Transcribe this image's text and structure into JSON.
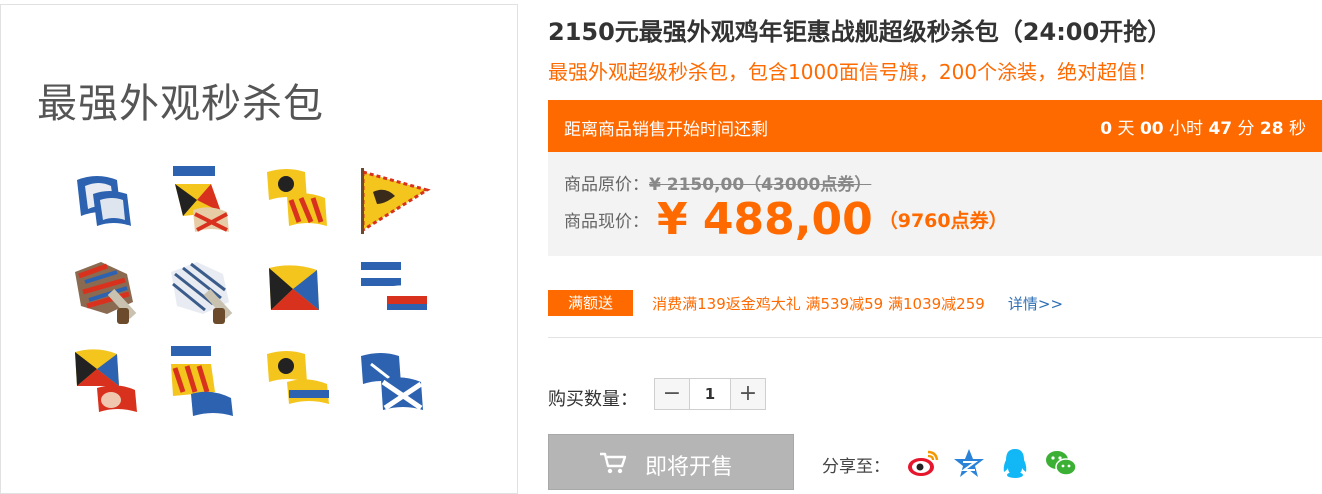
{
  "image_panel": {
    "title": "最强外观秒杀包"
  },
  "product": {
    "title": "2150元最强外观鸡年钜惠战舰超级秒杀包（24:00开抢）",
    "subtitle": "最强外观超级秒杀包，包含1000面信号旗，200个涂装，绝对超值！"
  },
  "countdown": {
    "label": "距离商品销售开始时间还剩",
    "days": "0",
    "days_unit": "天",
    "hours": "00",
    "hours_unit": "小时",
    "minutes": "47",
    "minutes_unit": "分",
    "seconds": "28",
    "seconds_unit": "秒"
  },
  "price": {
    "original_label": "商品原价：",
    "original_value": "¥ 2150,00（43000点券）",
    "current_label": "商品现价：",
    "current_value": "¥ 488,00",
    "current_points": "（9760点券）"
  },
  "promo": {
    "badge": "满额送",
    "text": "消费满139返金鸡大礼 满539减59 满1039减259",
    "detail_link": "详情>>"
  },
  "quantity": {
    "label": "购买数量：",
    "minus": "−",
    "plus": "+",
    "value": "1"
  },
  "buy_button": {
    "label": "即将开售",
    "icon": "cart-icon"
  },
  "share": {
    "label": "分享至：",
    "icons": [
      "weibo-icon",
      "qzone-icon",
      "qq-icon",
      "wechat-icon"
    ]
  },
  "colors": {
    "accent": "#ff6a00",
    "price_box_bg": "#f3f3f3",
    "disabled_button": "#b5b5b5",
    "link": "#2f6fb5"
  }
}
